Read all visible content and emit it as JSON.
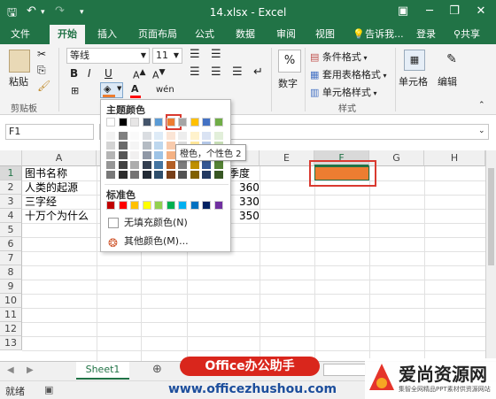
{
  "window": {
    "title": "14.xlsx - Excel",
    "icons": [
      "save-icon",
      "undo-icon",
      "redo-icon",
      "customize-icon",
      "ribbon-display-icon",
      "minimize-icon",
      "restore-icon",
      "close-icon"
    ]
  },
  "tabs": [
    "文件",
    "开始",
    "插入",
    "页面布局",
    "公式",
    "数据",
    "审阅",
    "视图"
  ],
  "tell_me": "告诉我...",
  "login": "登录",
  "share": "共享",
  "ribbon": {
    "paste": "粘贴",
    "clipboard": "剪贴板",
    "font_name": "等线",
    "font_size": "11",
    "bold": "B",
    "italic": "I",
    "underline": "U",
    "percent_label": "数字",
    "cond_format": "条件格式",
    "table_format": "套用表格格式",
    "cell_style": "单元格样式",
    "styles": "样式",
    "cells": "单元格",
    "editing": "编辑"
  },
  "formula_bar": {
    "name_box": "F1",
    "fx": "fx"
  },
  "columns": [
    "A",
    "B",
    "C",
    "D",
    "E",
    "F",
    "G",
    "H"
  ],
  "rows": [
    "1",
    "2",
    "3",
    "4",
    "5",
    "6",
    "7",
    "8",
    "9",
    "10",
    "11",
    "12",
    "13"
  ],
  "cells": {
    "a1": "图书名称",
    "a2": "人类的起源",
    "a3": "三字经",
    "a4": "十万个为什么",
    "d1": "季度",
    "d2": "360",
    "d3": "330",
    "d4": "350"
  },
  "palette": {
    "theme_title": "主题颜色",
    "standard_title": "标准色",
    "no_fill": "无填充颜色(N)",
    "more_colors": "其他颜色(M)...",
    "tooltip": "橙色，个性色 2",
    "selected_color": "#ed7d31",
    "theme_row": [
      "#ffffff",
      "#000000",
      "#e7e6e6",
      "#44546a",
      "#5b9bd5",
      "#ed7d31",
      "#a5a5a5",
      "#ffc000",
      "#4472c4",
      "#70ad47"
    ],
    "standard_row": [
      "#c00000",
      "#ff0000",
      "#ffc000",
      "#ffff00",
      "#92d050",
      "#00b050",
      "#00b0f0",
      "#0070c0",
      "#002060",
      "#7030a0"
    ]
  },
  "sheet_tab": "Sheet1",
  "status": "就绪",
  "watermark": {
    "badge": "Office办公助手",
    "url": "www.officezhushou.com",
    "brand": "爱尚资源网",
    "brand_sub": "集智全网精品PPT素材供资源网站"
  }
}
